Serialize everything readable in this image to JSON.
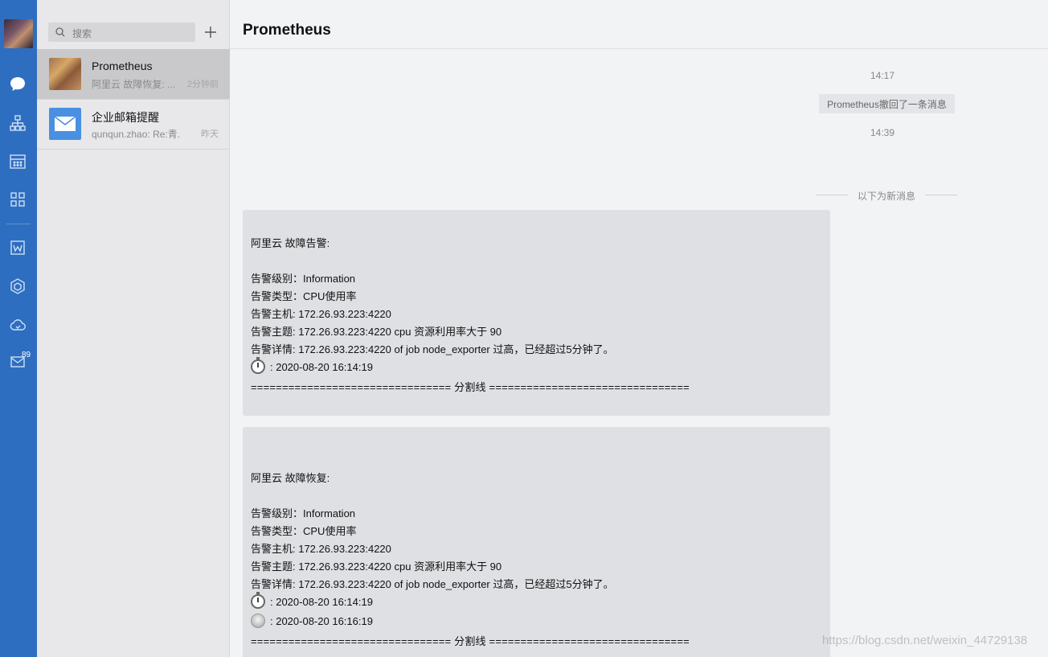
{
  "rail": {
    "mail_badge": "89",
    "icons": [
      "chat-icon",
      "org-icon",
      "calendar-icon",
      "apps-icon",
      "doc-icon",
      "box-icon",
      "cloud-icon",
      "mail-icon"
    ]
  },
  "search": {
    "placeholder": "搜索"
  },
  "sessions": [
    {
      "name": "Prometheus",
      "preview": "阿里云 故障恢复: ...",
      "time": "2分钟前",
      "active": true
    },
    {
      "name": "企业邮箱提醒",
      "preview": "qunqun.zhao: Re:青...",
      "time": "昨天",
      "active": false
    }
  ],
  "chat": {
    "title": "Prometheus",
    "time1": "14:17",
    "recall": "Prometheus撤回了一条消息",
    "time2": "14:39",
    "new_messages": "以下为新消息",
    "messages": [
      {
        "heading": "阿里云 故障告警:",
        "level": "告警级别：Information",
        "type": "告警类型：CPU使用率",
        "host": "告警主机: 172.26.93.223:4220",
        "subject": "告警主题: 172.26.93.223:4220 cpu 资源利用率大于 90",
        "detail": "告警详情: 172.26.93.223:4220 of job node_exporter 过高，已经超过5分钟了。",
        "start": ": 2020-08-20 16:14:19",
        "divider": "================================ 分割线  ================================"
      },
      {
        "heading": "阿里云 故障恢复:",
        "level": "告警级别：Information",
        "type": "告警类型：CPU使用率",
        "host": "告警主机: 172.26.93.223:4220",
        "subject": "告警主题: 172.26.93.223:4220 cpu 资源利用率大于 90",
        "detail": "告警详情: 172.26.93.223:4220 of job node_exporter 过高，已经超过5分钟了。",
        "start": ": 2020-08-20 16:14:19",
        "end": ": 2020-08-20 16:16:19",
        "divider": "================================ 分割线  ================================"
      }
    ]
  },
  "watermark": "https://blog.csdn.net/weixin_44729138",
  "colors": {
    "rail": "#2e6ec0",
    "list_bg": "#e8e8ea",
    "chat_bg": "#f2f3f5",
    "bubble": "#dfe0e3",
    "mail_avatar": "#4a90e2"
  }
}
